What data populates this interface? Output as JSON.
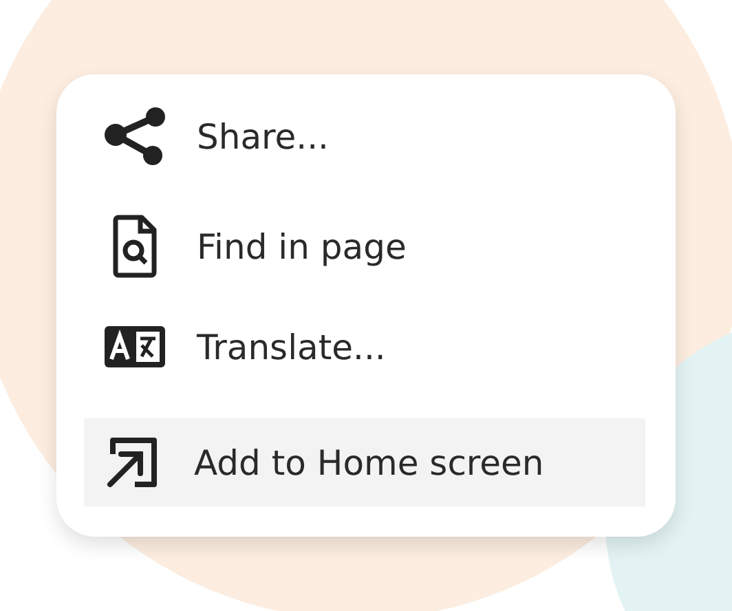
{
  "menu": {
    "items": [
      {
        "kind": "share",
        "label": "Share...",
        "selected": false
      },
      {
        "kind": "find",
        "label": "Find in page",
        "selected": false
      },
      {
        "kind": "translate",
        "label": "Translate...",
        "selected": false
      },
      {
        "kind": "add-home",
        "label": "Add to Home screen",
        "selected": true
      }
    ]
  }
}
